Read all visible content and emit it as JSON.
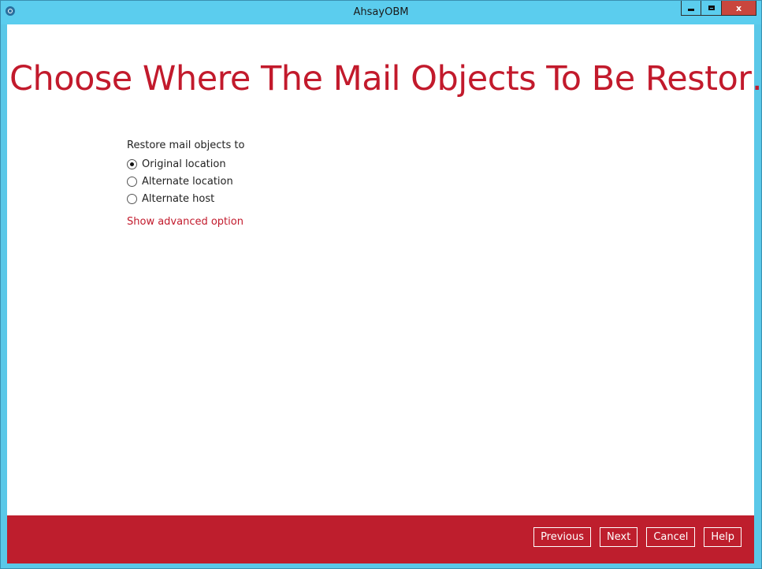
{
  "window": {
    "title": "AhsayOBM",
    "controls": [
      "minimize",
      "maximize",
      "close"
    ],
    "close_glyph": "x"
  },
  "page": {
    "heading": "Choose Where The Mail Objects To Be Restor…"
  },
  "restore": {
    "group_label": "Restore mail objects to",
    "options": [
      {
        "label": "Original location",
        "checked": true
      },
      {
        "label": "Alternate location",
        "checked": false
      },
      {
        "label": "Alternate host",
        "checked": false
      }
    ],
    "advanced_link": "Show advanced option"
  },
  "footer": {
    "buttons": {
      "previous": "Previous",
      "next": "Next",
      "cancel": "Cancel",
      "help": "Help"
    }
  },
  "colors": {
    "accent": "#c21a2c",
    "footer_bg": "#be1e2d",
    "titlebar_bg": "#5bcdee"
  }
}
